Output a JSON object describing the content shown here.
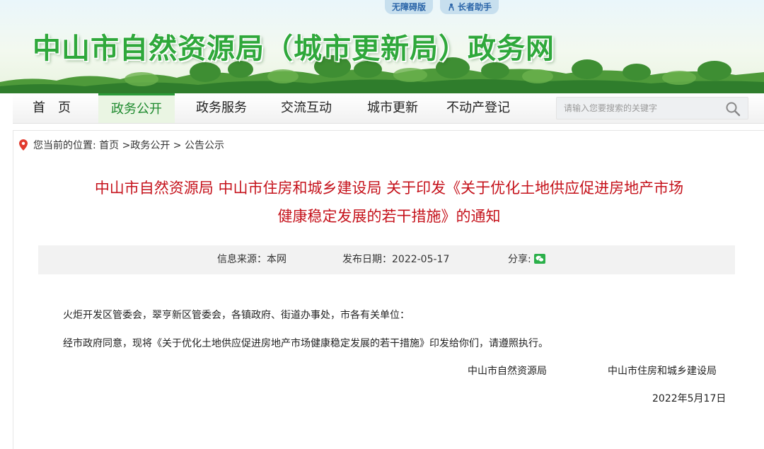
{
  "header": {
    "accessibility_label": "无障碍版",
    "elder_label": "长者助手",
    "site_title": "中山市自然资源局（城市更新局）政务网"
  },
  "nav": {
    "items": [
      {
        "label": "首　页"
      },
      {
        "label": "政务公开"
      },
      {
        "label": "政务服务"
      },
      {
        "label": "交流互动"
      },
      {
        "label": "城市更新"
      },
      {
        "label": "不动产登记"
      }
    ],
    "active_index": 1,
    "search_placeholder": "请输入您要搜索的关键字"
  },
  "breadcrumb": {
    "text": "您当前的位置:  首页 >政务公开 > 公告公示"
  },
  "article": {
    "title_line1": "中山市自然资源局 中山市住房和城乡建设局 关于印发《关于优化土地供应促进房地产市场",
    "title_line2": "健康稳定发展的若干措施》的通知",
    "source": "信息来源：本网",
    "date": "发布日期：2022-05-17",
    "share": "分享:",
    "salutation": "火炬开发区管委会，翠亨新区管委会，各镇政府、街道办事处，市各有关单位：",
    "body": "经市政府同意，现将《关于优化土地供应促进房地产市场健康稳定发展的若干措施》印发给你们，请遵照执行。",
    "signer1": "中山市自然资源局",
    "signer2": "中山市住房和城乡建设局",
    "sign_date": "2022年5月17日"
  },
  "colors": {
    "title_red": "#c5121b",
    "brand_green": "#2fa83b",
    "badge_blue": "#2a64a8"
  }
}
